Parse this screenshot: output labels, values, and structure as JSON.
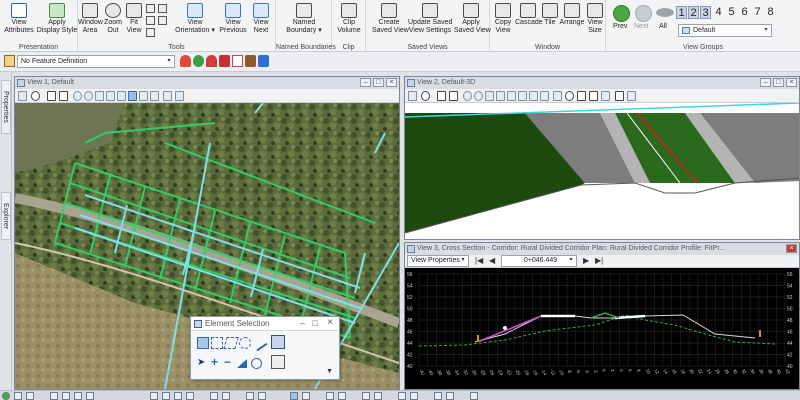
{
  "ribbon": {
    "presentation": {
      "label": "Presentation",
      "buttons": [
        {
          "label1": "View",
          "label2": "Attributes"
        },
        {
          "label1": "Apply",
          "label2": "Display Style"
        }
      ]
    },
    "tools": {
      "label": "Tools",
      "buttons": [
        {
          "label1": "Window",
          "label2": "Area"
        },
        {
          "label1": "Zoom",
          "label2": "Out"
        },
        {
          "label1": "Fit",
          "label2": "View"
        },
        {
          "label1": "View",
          "label2": "Orientation ▾"
        },
        {
          "label1": "View",
          "label2": "Previous"
        },
        {
          "label1": "View",
          "label2": "Next"
        }
      ]
    },
    "named_boundaries": {
      "label": "Named Boundaries",
      "button": {
        "label1": "Named",
        "label2": "Boundary ▾"
      }
    },
    "clip": {
      "label": "Clip",
      "button": {
        "label1": "Clip",
        "label2": "Volume"
      }
    },
    "saved_views": {
      "label": "Saved Views",
      "buttons": [
        {
          "label1": "Create",
          "label2": "Saved View"
        },
        {
          "label1": "Update Saved",
          "label2": "View Settings"
        },
        {
          "label1": "Apply",
          "label2": "Saved View"
        }
      ]
    },
    "window": {
      "label": "Window",
      "buttons": [
        {
          "label1": "Copy",
          "label2": "View"
        },
        {
          "label1": "Cascade",
          "label2": ""
        },
        {
          "label1": "Tile",
          "label2": ""
        },
        {
          "label1": "Arrange",
          "label2": ""
        },
        {
          "label1": "View",
          "label2": "Size"
        }
      ]
    },
    "view_groups": {
      "label": "View Groups",
      "prev": "Prev",
      "next": "Next",
      "all": "All",
      "numbers": [
        "1",
        "2",
        "3",
        "4",
        "5",
        "6",
        "7",
        "8"
      ],
      "selected": "Default"
    }
  },
  "toolbar2": {
    "feature_definition": "No Feature Definition"
  },
  "sidebar": {
    "tabs": [
      "Properties",
      "Explorer"
    ]
  },
  "view1": {
    "title": "View 1, Default"
  },
  "view2": {
    "title": "View 2, Default-3D"
  },
  "view3": {
    "title": "View 3, Cross Section - Corridor: Rural Divided Corridor Plan: Rural Divided Corridor Profile: FitPr...",
    "view_properties": "View Properties",
    "station": "0+046.449",
    "y_ticks": [
      "56",
      "54",
      "52",
      "50",
      "48",
      "46",
      "44",
      "42",
      "40"
    ],
    "x_ticks": [
      "-42",
      "-40",
      "-38",
      "-36",
      "-34",
      "-32",
      "-30",
      "-28",
      "-26",
      "-24",
      "-22",
      "-20",
      "-18",
      "-16",
      "-14",
      "-12",
      "-10",
      "-8",
      "-6",
      "-4",
      "-2",
      "0",
      "2",
      "4",
      "6",
      "8",
      "10",
      "12",
      "14",
      "16",
      "18",
      "20",
      "22",
      "24",
      "26",
      "28",
      "30",
      "32",
      "34",
      "36",
      "38",
      "40",
      "42"
    ]
  },
  "element_selection": {
    "title": "Element Selection"
  },
  "colors": {
    "accent": "#3d74b8",
    "design_green": "#2fd26b",
    "design_cyan": "#7fe0e8",
    "cross_section_grid": "#3a3a3a"
  }
}
